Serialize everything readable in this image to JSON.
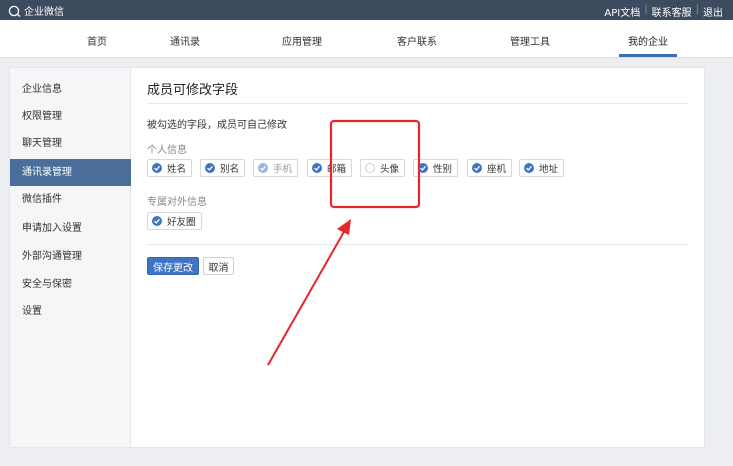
{
  "app": {
    "title": "企业微信"
  },
  "top_links": [
    "API文档",
    "联系客服",
    "退出"
  ],
  "nav": [
    "首页",
    "通讯录",
    "应用管理",
    "客户联系",
    "管理工具",
    "我的企业"
  ],
  "nav_active_index": 5,
  "sidebar": {
    "items": [
      "企业信息",
      "权限管理",
      "聊天管理",
      "通讯录管理",
      "微信插件",
      "申请加入设置",
      "外部沟通管理",
      "安全与保密",
      "设置"
    ],
    "active_index": 3
  },
  "content": {
    "title": "成员可修改字段",
    "description": "被勾选的字段，成员可自己修改",
    "personal_label": "个人信息",
    "personal_fields": [
      {
        "label": "姓名",
        "checked": true,
        "disabled": false
      },
      {
        "label": "别名",
        "checked": true,
        "disabled": false
      },
      {
        "label": "手机",
        "checked": true,
        "disabled": true
      },
      {
        "label": "邮箱",
        "checked": true,
        "disabled": false
      },
      {
        "label": "头像",
        "checked": false,
        "disabled": false
      },
      {
        "label": "性别",
        "checked": true,
        "disabled": false
      },
      {
        "label": "座机",
        "checked": true,
        "disabled": false
      },
      {
        "label": "地址",
        "checked": true,
        "disabled": false
      }
    ],
    "external_label": "专属对外信息",
    "external_fields": [
      {
        "label": "好友圈",
        "checked": true,
        "disabled": false
      }
    ]
  },
  "buttons": {
    "save": "保存更改",
    "cancel": "取消"
  },
  "colors": {
    "topbar": "#3d4b5f",
    "accent": "#3f74c4",
    "annotation": "#e8262a"
  }
}
